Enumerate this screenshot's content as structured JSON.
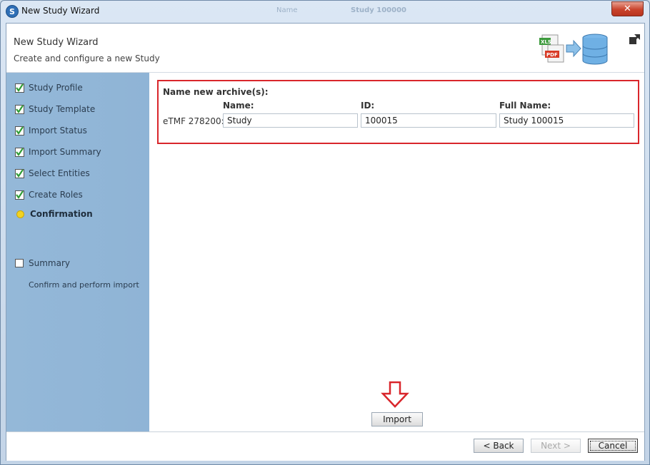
{
  "window": {
    "title": "New Study Wizard",
    "close_label": "✕",
    "background_text_1": "Name",
    "background_text_2": "Study 100000"
  },
  "header": {
    "title": "New Study Wizard",
    "subtitle": "Create and configure a new Study",
    "graphic_xls": "XLS",
    "graphic_pdf": "PDF"
  },
  "sidebar": {
    "steps": [
      {
        "label": "Study Profile",
        "state": "done"
      },
      {
        "label": "Study Template",
        "state": "done"
      },
      {
        "label": "Import Status",
        "state": "done"
      },
      {
        "label": "Import Summary",
        "state": "done"
      },
      {
        "label": "Select Entities",
        "state": "done"
      },
      {
        "label": "Create Roles",
        "state": "done"
      },
      {
        "label": "Confirmation",
        "state": "current"
      },
      {
        "label": "Summary",
        "state": "pending"
      }
    ],
    "current_description": "Confirm and perform import"
  },
  "archive": {
    "section_title": "Name new archive(s):",
    "columns": {
      "name": "Name:",
      "id": "ID:",
      "full_name": "Full Name:"
    },
    "row_label": "eTMF 278200:",
    "name_value": "Study",
    "id_value": "100015",
    "full_name_value": "Study 100015"
  },
  "main": {
    "import_label": "Import"
  },
  "footer": {
    "back_label": "< Back",
    "next_label": "Next >",
    "cancel_label": "Cancel"
  },
  "colors": {
    "highlight_border": "#d9262b",
    "sidebar_bg": "#94b8d8",
    "current_step_dot": "#f2d221",
    "checkmark": "#2e9b34"
  }
}
